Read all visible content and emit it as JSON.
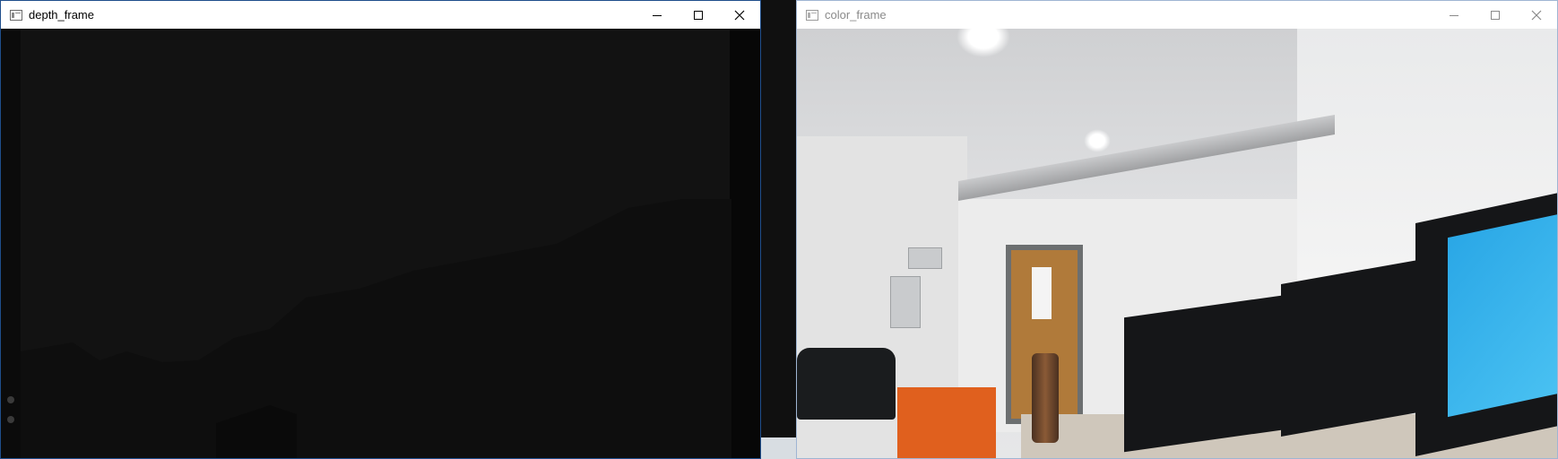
{
  "windows": {
    "depth": {
      "title": "depth_frame",
      "active": true
    },
    "color": {
      "title": "color_frame",
      "active": false
    }
  },
  "controls": {
    "minimize_icon": "minimize-icon",
    "maximize_icon": "maximize-icon",
    "close_icon": "close-icon"
  },
  "colors": {
    "active_border": "#1f4e8c",
    "inactive_title_text": "#8a8a8a",
    "depth_background": "#121212"
  }
}
